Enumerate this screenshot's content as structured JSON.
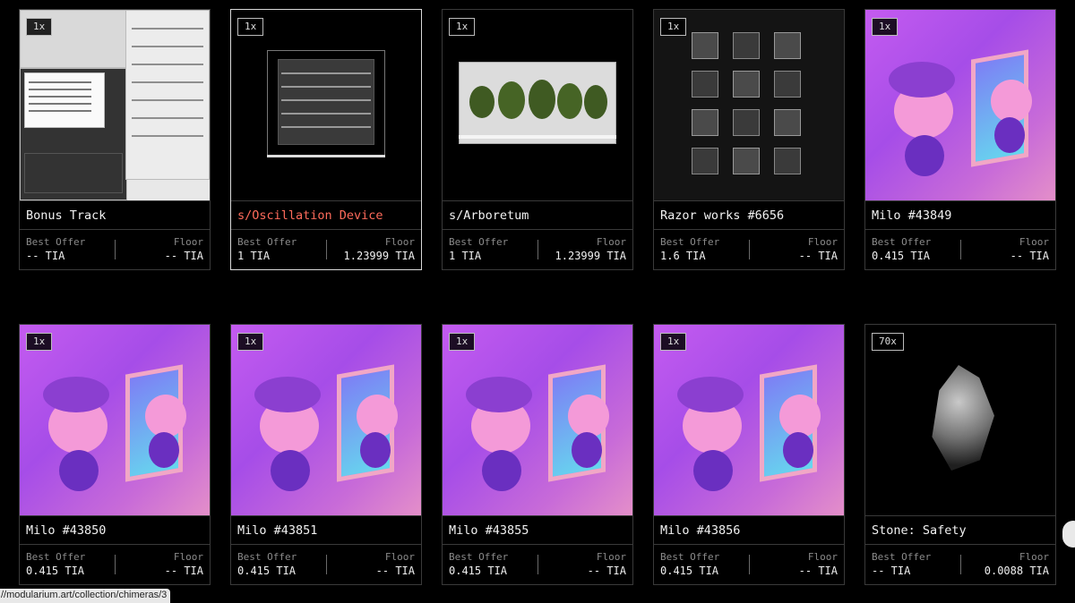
{
  "cards": [
    {
      "qty": "1x",
      "title": "Bonus Track",
      "best_offer_label": "Best Offer",
      "best_offer": "-- TIA",
      "floor_label": "Floor",
      "floor": "-- TIA"
    },
    {
      "qty": "1x",
      "title": "s/Oscillation Device",
      "best_offer_label": "Best Offer",
      "best_offer": "1 TIA",
      "floor_label": "Floor",
      "floor": "1.23999 TIA",
      "selected": true
    },
    {
      "qty": "1x",
      "title": "s/Arboretum",
      "best_offer_label": "Best Offer",
      "best_offer": "1 TIA",
      "floor_label": "Floor",
      "floor": "1.23999 TIA"
    },
    {
      "qty": "1x",
      "title": "Razor works #6656",
      "best_offer_label": "Best Offer",
      "best_offer": "1.6 TIA",
      "floor_label": "Floor",
      "floor": "-- TIA"
    },
    {
      "qty": "1x",
      "title": "Milo #43849",
      "best_offer_label": "Best Offer",
      "best_offer": "0.415 TIA",
      "floor_label": "Floor",
      "floor": "-- TIA"
    },
    {
      "qty": "1x",
      "title": "Milo #43850",
      "best_offer_label": "Best Offer",
      "best_offer": "0.415 TIA",
      "floor_label": "Floor",
      "floor": "-- TIA"
    },
    {
      "qty": "1x",
      "title": "Milo #43851",
      "best_offer_label": "Best Offer",
      "best_offer": "0.415 TIA",
      "floor_label": "Floor",
      "floor": "-- TIA"
    },
    {
      "qty": "1x",
      "title": "Milo #43855",
      "best_offer_label": "Best Offer",
      "best_offer": "0.415 TIA",
      "floor_label": "Floor",
      "floor": "-- TIA"
    },
    {
      "qty": "1x",
      "title": "Milo #43856",
      "best_offer_label": "Best Offer",
      "best_offer": "0.415 TIA",
      "floor_label": "Floor",
      "floor": "-- TIA"
    },
    {
      "qty": "70x",
      "title": "Stone: Safety",
      "best_offer_label": "Best Offer",
      "best_offer": "-- TIA",
      "floor_label": "Floor",
      "floor": "0.0088 TIA"
    }
  ],
  "status_url": "//modularium.art/collection/chimeras/3",
  "colors": {
    "background": "#000000",
    "accent_title": "#ff6b5b",
    "border": "#3a3a3a",
    "milo_purple": "#b052ef"
  }
}
